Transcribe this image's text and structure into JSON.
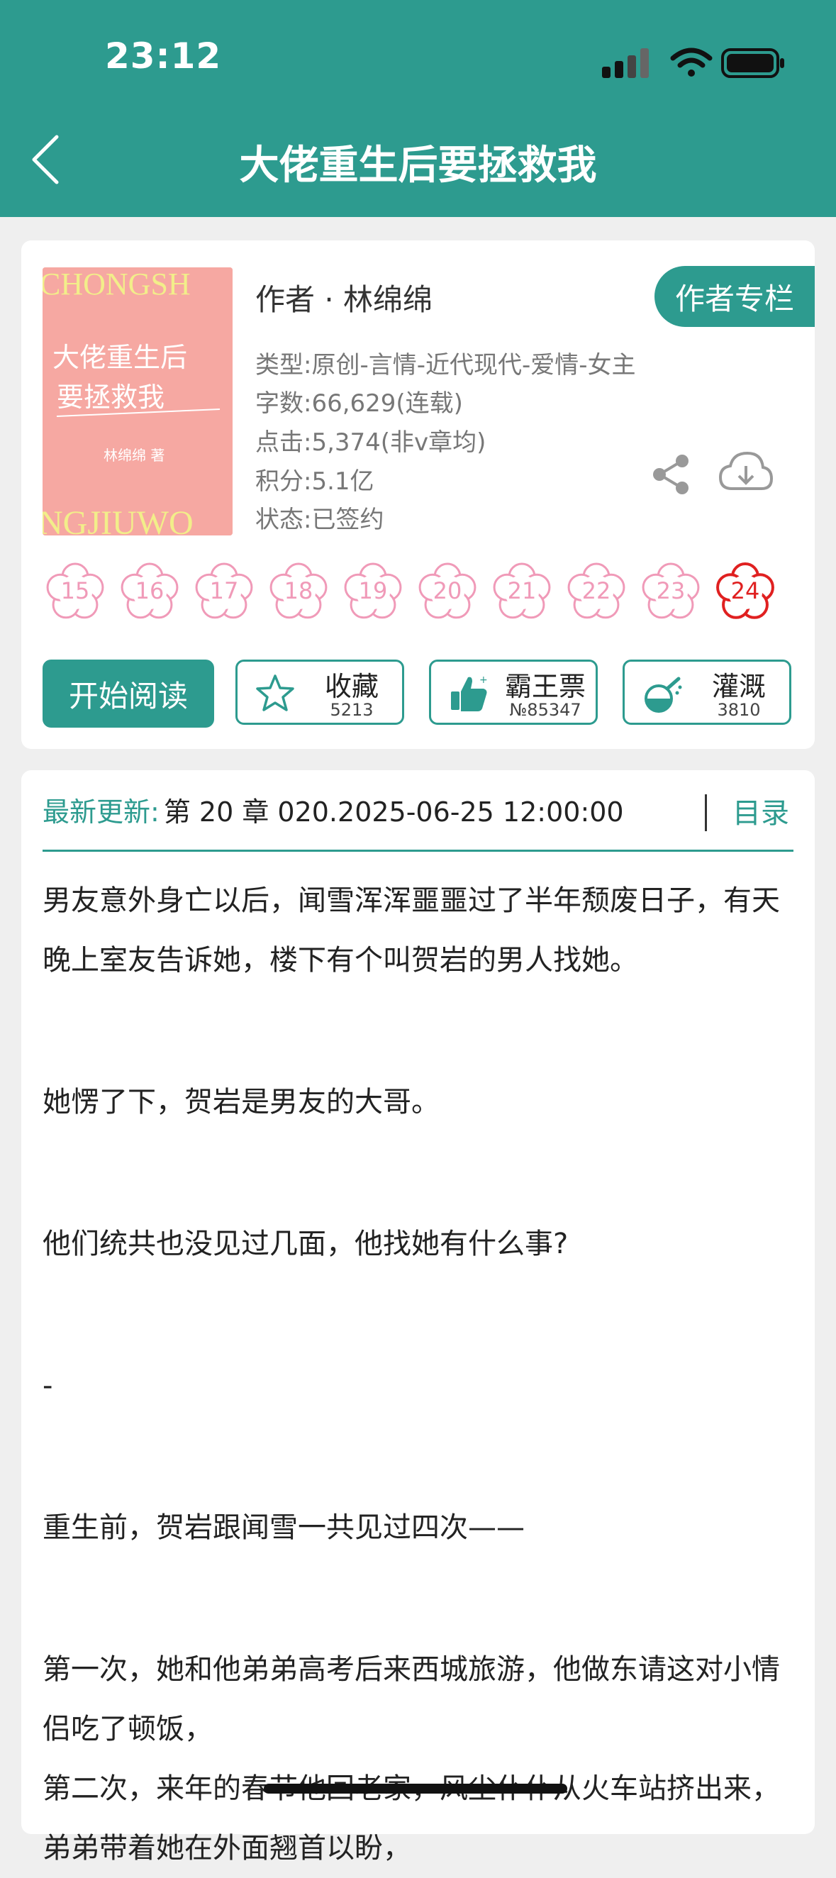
{
  "status_bar": {
    "time": "23:12"
  },
  "header": {
    "title": "大佬重生后要拯救我"
  },
  "book": {
    "cover": {
      "top_text": "CHONGSH",
      "title_line1": "大佬重生后",
      "title_line2": "要拯救我",
      "author_text": "林绵绵 著",
      "bottom_text": "NGJIUWO"
    },
    "author": "作者 · 林绵绵",
    "author_column_button": "作者专栏",
    "type": "类型:原创-言情-近代现代-爱情-女主",
    "words": "字数:66,629(连载)",
    "clicks": "点击:5,374(非v章均)",
    "score": "积分:5.1亿",
    "status": "状态:已签约"
  },
  "chapters": [
    "15",
    "16",
    "17",
    "18",
    "19",
    "20",
    "21",
    "22",
    "23",
    "24"
  ],
  "active_chapter": "24",
  "actions": {
    "start_reading": "开始阅读",
    "favorite": {
      "label": "收藏",
      "count": "5213"
    },
    "tickets": {
      "label": "霸王票",
      "count": "№85347"
    },
    "water": {
      "label": "灌溉",
      "count": "3810"
    }
  },
  "update": {
    "label": "最新更新:",
    "text": "第 20 章 020.2025-06-25 12:00:00",
    "toc": "目录"
  },
  "excerpt": [
    "男友意外身亡以后，闻雪浑浑噩噩过了半年颓废日子，有天晚上室友告诉她，楼下有个叫贺岩的男人找她。",
    "",
    "她愣了下，贺岩是男友的大哥。",
    "",
    "他们统共也没见过几面，他找她有什么事?",
    "",
    "-",
    "",
    "重生前，贺岩跟闻雪一共见过四次——",
    "",
    "第一次，她和他弟弟高考后来西城旅游，他做东请这对小情侣吃了顿饭，",
    "第二次，来年的春节他回老家，风尘仆仆从火车站挤出来，弟弟带着她在外面翘首以盼，"
  ],
  "colors": {
    "primary": "#2d9b8f",
    "cover": "#f6a8a2",
    "flower": "#f09ab8",
    "flower_active": "#e02020"
  }
}
